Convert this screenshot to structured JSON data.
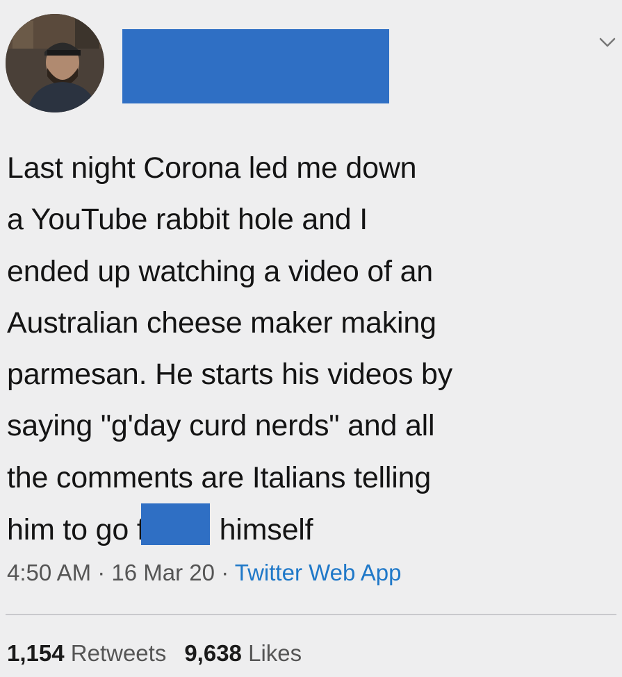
{
  "tweet": {
    "text_lines": [
      "Last night Corona led me down",
      "a YouTube rabbit hole and I",
      "ended up watching a video of an",
      "Australian cheese maker making",
      "parmesan. He starts his videos by",
      "saying \"g'day curd nerds\" and all",
      "the comments are Italians telling"
    ],
    "last_line_before": "him to go f",
    "last_line_after": "himself",
    "time": "4:50 AM",
    "date": "16 Mar 20",
    "separator": "·",
    "source": "Twitter Web App",
    "retweets_count": "1,154",
    "retweets_label": "Retweets",
    "likes_count": "9,638",
    "likes_label": "Likes"
  },
  "colors": {
    "redaction": "#2f6fc4",
    "link": "#1f78c8",
    "background": "#eeeeef"
  },
  "icons": {
    "menu": "chevron-down-icon",
    "avatar": "user-avatar"
  }
}
